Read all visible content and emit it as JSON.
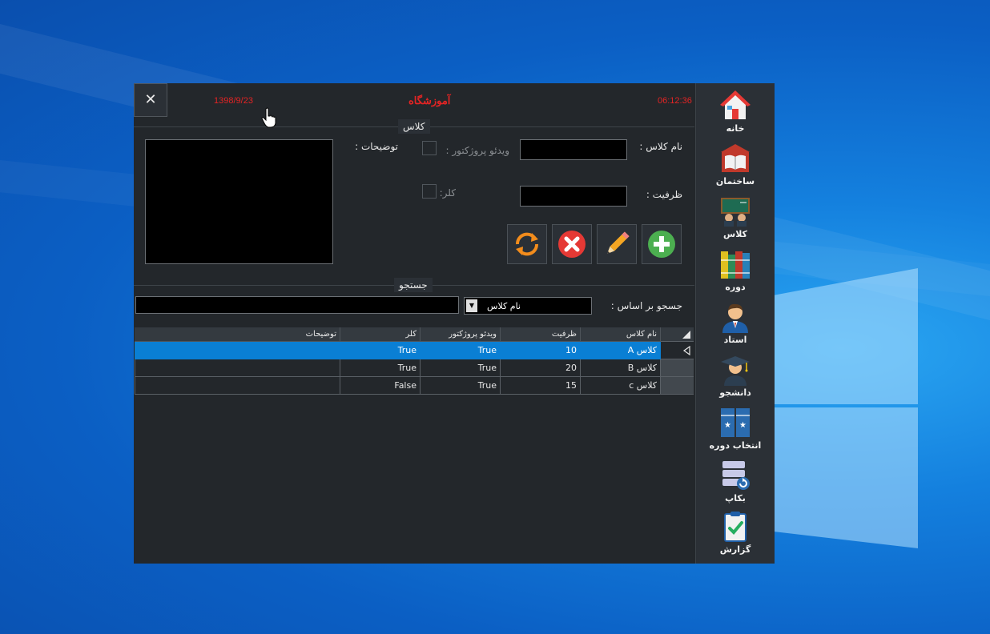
{
  "header": {
    "date": "1398/9/23",
    "title": "آموزشگاه",
    "time": "06:12:36",
    "close_label": "✕"
  },
  "class_group": {
    "title": "کلاس",
    "name_label": "نام کلاس :",
    "name_value": "",
    "capacity_label": "ظرفیت :",
    "capacity_value": "",
    "video_projector_label": "ویدئو  پروژکتور :",
    "color_label": "کلر:",
    "description_label": "توضیحات :",
    "description_value": ""
  },
  "actions": {
    "add": "add",
    "edit": "edit",
    "delete": "delete",
    "refresh": "refresh"
  },
  "search_group": {
    "title": "جستجو",
    "search_by_label": "جسجو بر اساس  :",
    "search_by_value": "نام کلاس",
    "search_value": ""
  },
  "table": {
    "columns": [
      "نام کلاس",
      "ظرفیت",
      "ویدئو پروژکتور",
      "کلر",
      "توضیحات"
    ],
    "rows": [
      [
        "کلاس A",
        "10",
        "True",
        "True",
        ""
      ],
      [
        "کلاس B",
        "20",
        "True",
        "True",
        ""
      ],
      [
        "کلاس c",
        "15",
        "True",
        "False",
        ""
      ]
    ],
    "selected_row": 0
  },
  "sidebar": {
    "items": [
      {
        "label": "خانه",
        "icon": "home-icon"
      },
      {
        "label": "ساختمان",
        "icon": "building-book-icon"
      },
      {
        "label": "کلاس",
        "icon": "classroom-icon"
      },
      {
        "label": "دوره",
        "icon": "books-icon"
      },
      {
        "label": "استاد",
        "icon": "teacher-icon"
      },
      {
        "label": "دانشجو",
        "icon": "student-icon"
      },
      {
        "label": "انتخاب دوره",
        "icon": "course-select-icon"
      },
      {
        "label": "بکاپ",
        "icon": "backup-icon"
      },
      {
        "label": "گزارش",
        "icon": "report-icon"
      }
    ]
  },
  "colors": {
    "header_red": "#e32424",
    "selection_blue": "#0a7fd4",
    "panel_dark": "#23272b",
    "sidebar_dark": "#2b3036"
  }
}
